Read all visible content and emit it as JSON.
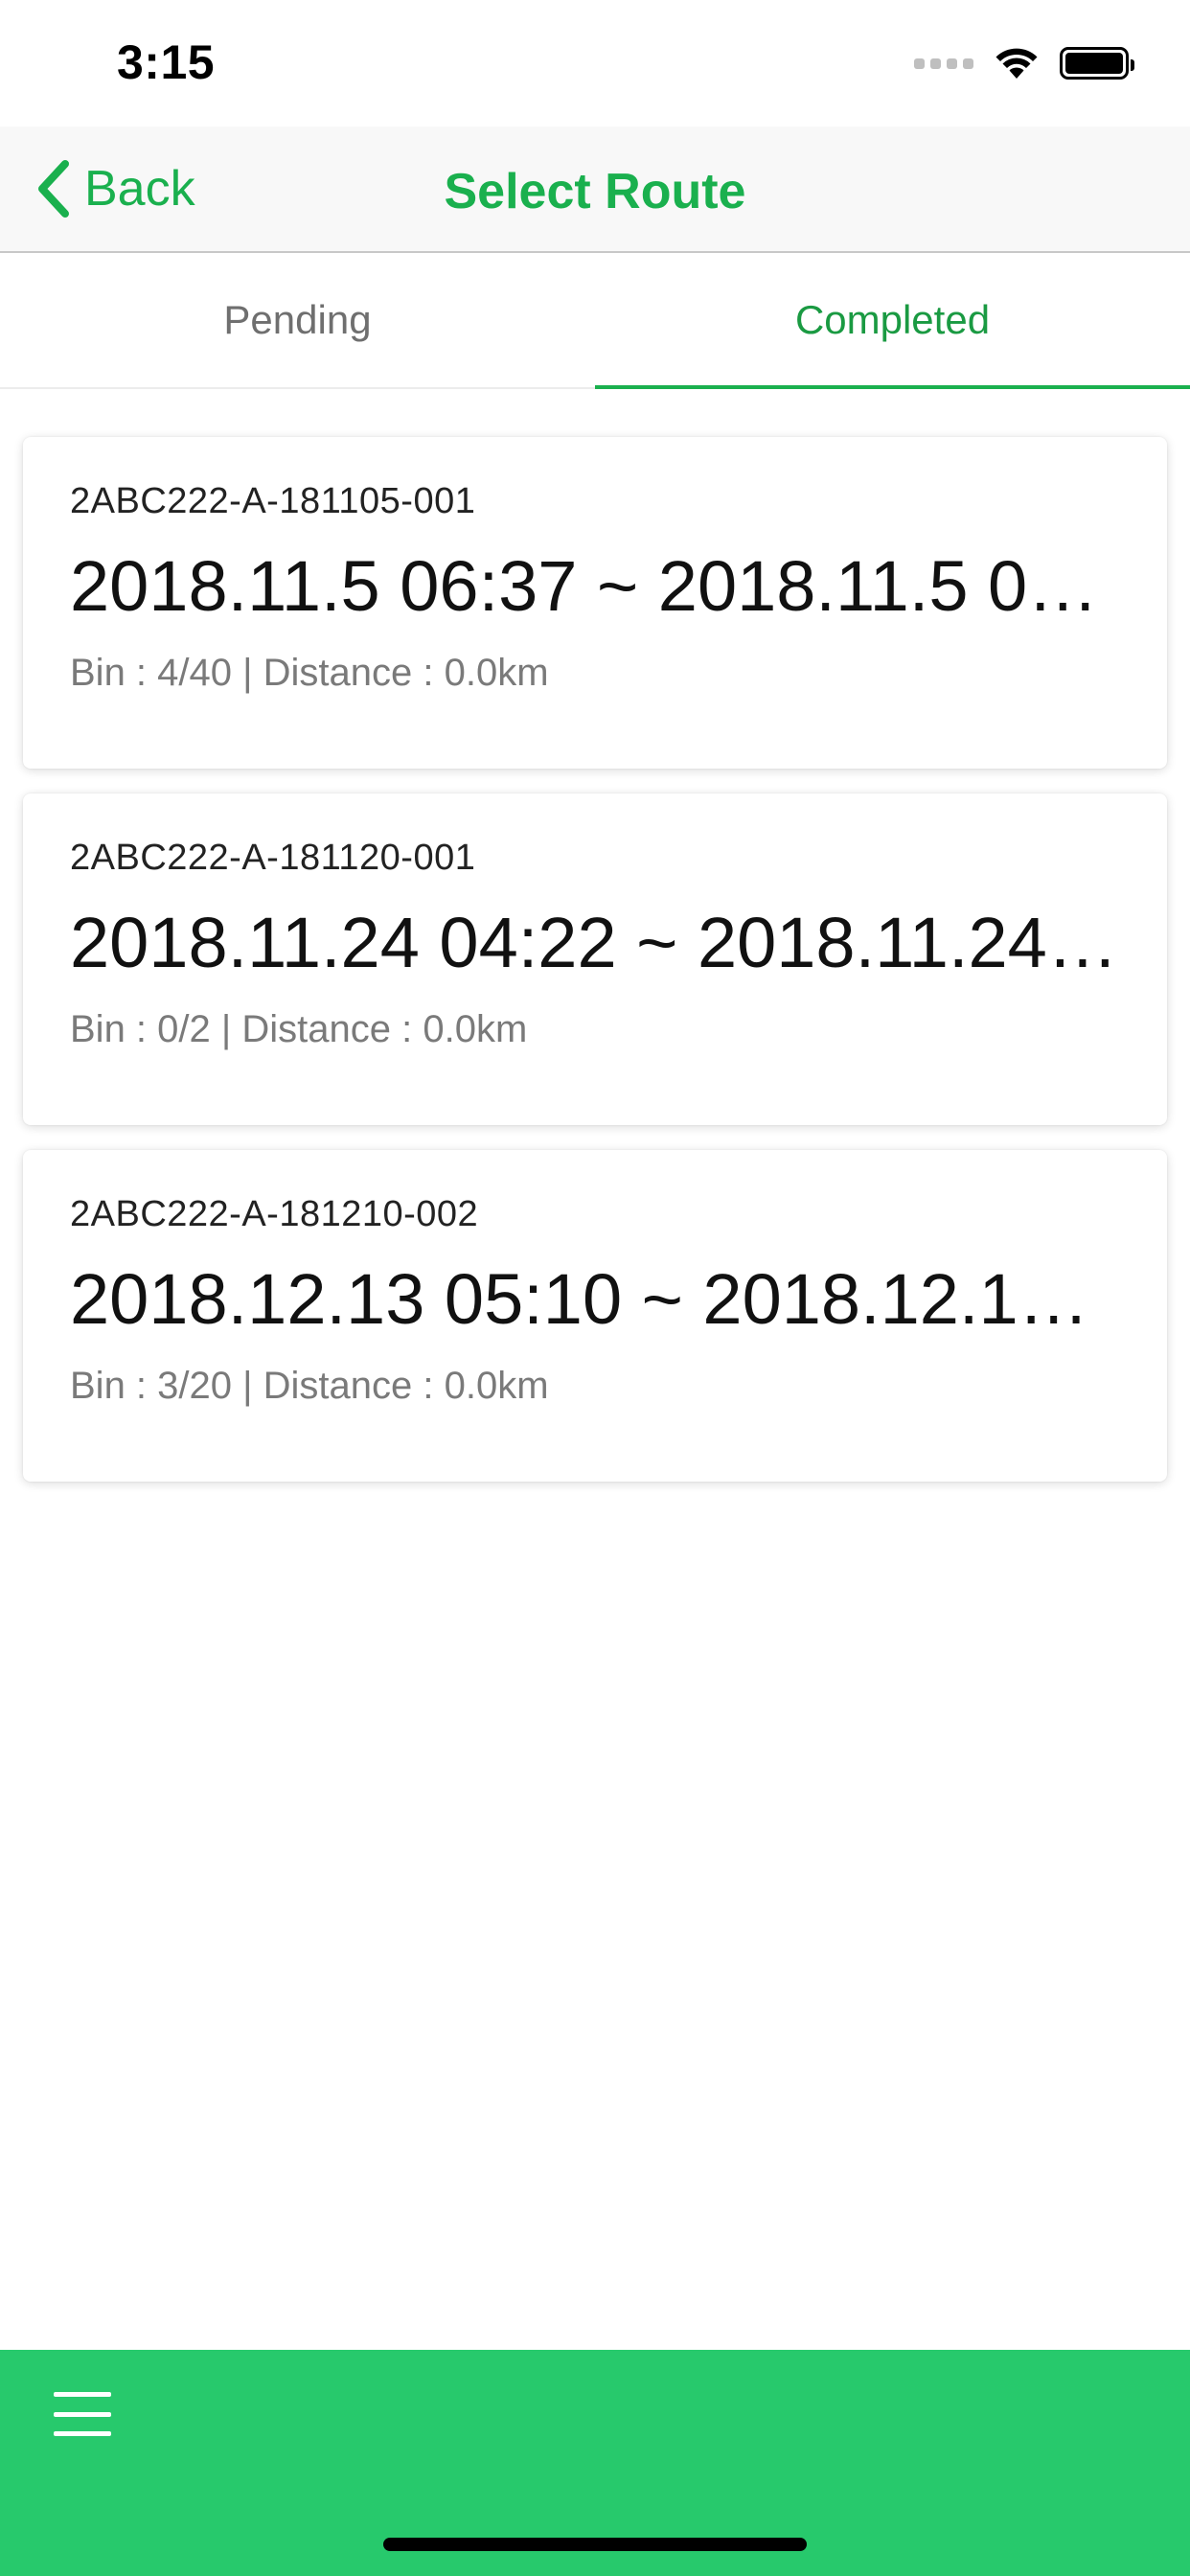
{
  "status_bar": {
    "time": "3:15"
  },
  "nav": {
    "back_label": "Back",
    "title": "Select Route",
    "accent_color": "#1ab04e"
  },
  "tabs": [
    {
      "label": "Pending",
      "active": false
    },
    {
      "label": "Completed",
      "active": true
    }
  ],
  "routes": [
    {
      "id": "2ABC222-A-181105-001",
      "time_range": "2018.11.5 06:37 ~ 2018.11.5 06…",
      "meta": "Bin : 4/40 | Distance : 0.0km"
    },
    {
      "id": "2ABC222-A-181120-001",
      "time_range": "2018.11.24 04:22 ~ 2018.11.24…",
      "meta": "Bin : 0/2 | Distance : 0.0km"
    },
    {
      "id": "2ABC222-A-181210-002",
      "time_range": "2018.12.13 05:10 ~ 2018.12.13…",
      "meta": "Bin : 3/20 | Distance : 0.0km"
    }
  ],
  "bottom_bar": {
    "color": "#27c96c",
    "menu_icon": "hamburger-menu-icon"
  }
}
